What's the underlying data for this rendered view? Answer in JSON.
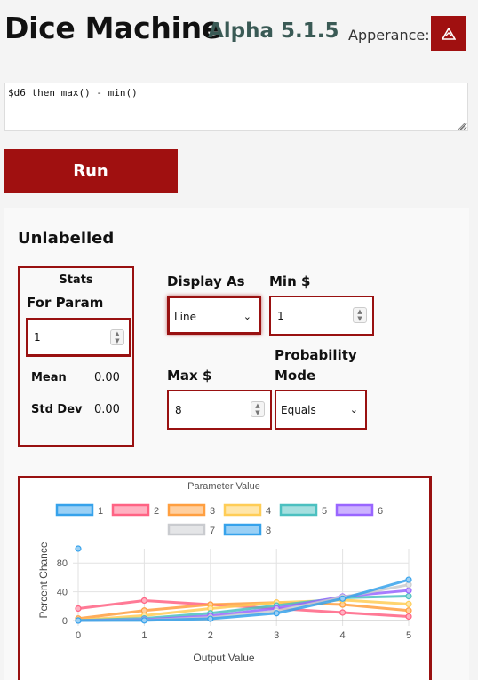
{
  "header": {
    "title": "Dice Machine",
    "version": "Alpha 5.1.5",
    "appearance_label": "Apperance:"
  },
  "editor": {
    "code": "$d6 then max() - min()"
  },
  "run_label": "Run",
  "panel": {
    "title": "Unlabelled",
    "stats": {
      "heading": "Stats",
      "for_param_label": "For Param",
      "param_value": "1",
      "mean_label": "Mean",
      "mean_value": "0.00",
      "std_label": "Std Dev",
      "std_value": "0.00"
    },
    "display_as": {
      "label": "Display As",
      "value": "Line"
    },
    "min": {
      "label": "Min $",
      "value": "1"
    },
    "max": {
      "label": "Max $",
      "value": "8"
    },
    "probability_mode": {
      "label_line1": "Probability",
      "label_line2": "Mode",
      "value": "Equals"
    }
  },
  "colors": {
    "accent": "#a01010",
    "version": "#3a5a55"
  },
  "chart_data": {
    "type": "line",
    "title": "Parameter Value",
    "xlabel": "Output Value",
    "ylabel": "Percent Chance",
    "x": [
      0,
      1,
      2,
      3,
      4,
      5
    ],
    "yticks": [
      0,
      40,
      80
    ],
    "ylim": [
      0,
      100
    ],
    "legend_placement": "top",
    "series": [
      {
        "name": "1",
        "color": "#36a2eb",
        "fill": "#9ad0f5",
        "values": [
          100,
          null,
          null,
          null,
          null,
          null
        ]
      },
      {
        "name": "2",
        "color": "#ff6384",
        "fill": "#ffb1c1",
        "values": [
          16.7,
          27.8,
          22.2,
          16.7,
          11.1,
          5.6
        ]
      },
      {
        "name": "3",
        "color": "#ff9f40",
        "fill": "#ffcf9f",
        "values": [
          2.8,
          13.9,
          22.2,
          25,
          22.2,
          13.9
        ]
      },
      {
        "name": "4",
        "color": "#ffcd56",
        "fill": "#ffe6aa",
        "values": [
          0.5,
          6.9,
          16.7,
          25,
          28.5,
          22.9
        ]
      },
      {
        "name": "5",
        "color": "#4bc0c0",
        "fill": "#a5dfdf",
        "values": [
          0.1,
          3,
          10.2,
          20.8,
          31.6,
          33.9
        ]
      },
      {
        "name": "6",
        "color": "#9966ff",
        "fill": "#ccb2ff",
        "values": [
          0,
          1.3,
          6.4,
          17,
          33.3,
          41.9
        ]
      },
      {
        "name": "7",
        "color": "#c9cbcf",
        "fill": "#e4e5e7",
        "values": [
          0,
          0.5,
          4,
          13.3,
          32.4,
          49.8
        ]
      },
      {
        "name": "8",
        "color": "#36a2eb",
        "fill": "#9ad0f5",
        "values": [
          0,
          0.2,
          2.4,
          10.2,
          30.5,
          56.7
        ]
      }
    ]
  }
}
